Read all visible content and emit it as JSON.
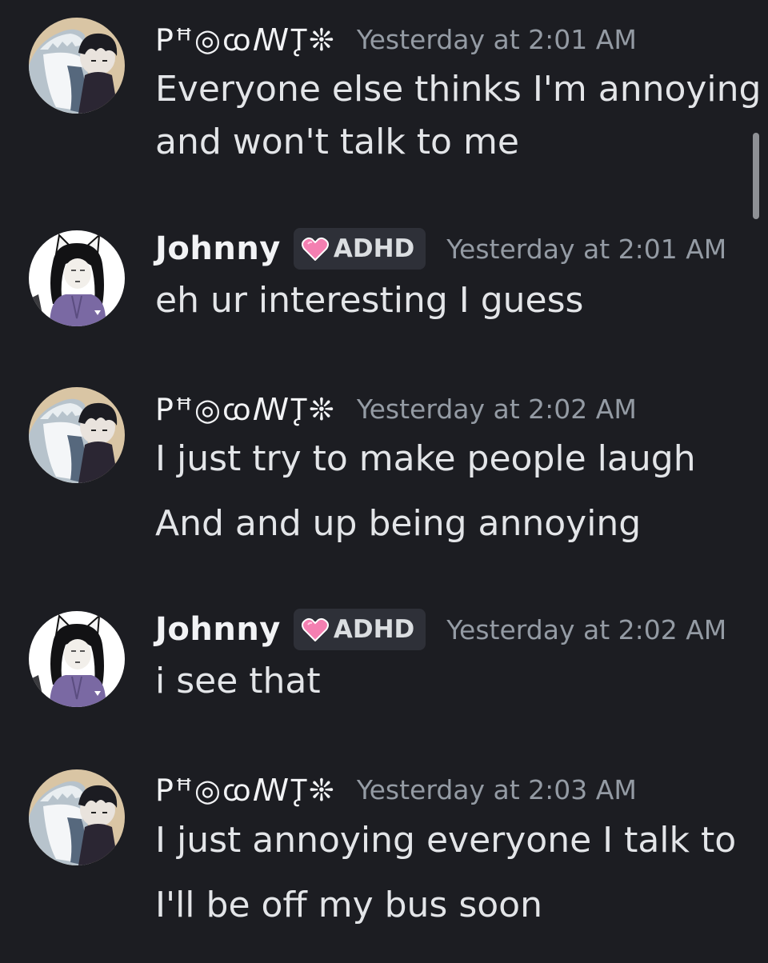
{
  "messages": [
    {
      "author": "ꓑꟸ◎ꭃꟿꚐ❊",
      "timestamp": "Yesterday at 2:01 AM",
      "lines": [
        "Everyone else thinks I'm annoying",
        "and won't talk to me"
      ],
      "avatar": "shark-hoodie-avatar"
    },
    {
      "author": "Johnny",
      "tag": "ADHD",
      "tag_icon": "pink-heart-icon",
      "timestamp": "Yesterday at 2:01 AM",
      "lines": [
        "eh ur interesting I guess"
      ],
      "avatar": "cat-ear-girl-avatar"
    },
    {
      "author": "ꓑꟸ◎ꭃꟿꚐ❊",
      "timestamp": "Yesterday at 2:02 AM",
      "lines": [
        "I just try to make people laugh",
        "And and up being annoying"
      ],
      "avatar": "shark-hoodie-avatar"
    },
    {
      "author": "Johnny",
      "tag": "ADHD",
      "tag_icon": "pink-heart-icon",
      "timestamp": "Yesterday at 2:02 AM",
      "lines": [
        "i see that"
      ],
      "avatar": "cat-ear-girl-avatar"
    },
    {
      "author": "ꓑꟸ◎ꭃꟿꚐ❊",
      "timestamp": "Yesterday at 2:03 AM",
      "lines": [
        "I just annoying everyone I talk to",
        "I'll be off my bus soon"
      ],
      "avatar": "shark-hoodie-avatar"
    }
  ],
  "colors": {
    "background": "#1c1d22",
    "username": "#f2f3f5",
    "timestamp": "#949ba4",
    "message_text": "#e3e5e8",
    "tag_background": "#2e3038",
    "heart": "#f47fb1"
  }
}
